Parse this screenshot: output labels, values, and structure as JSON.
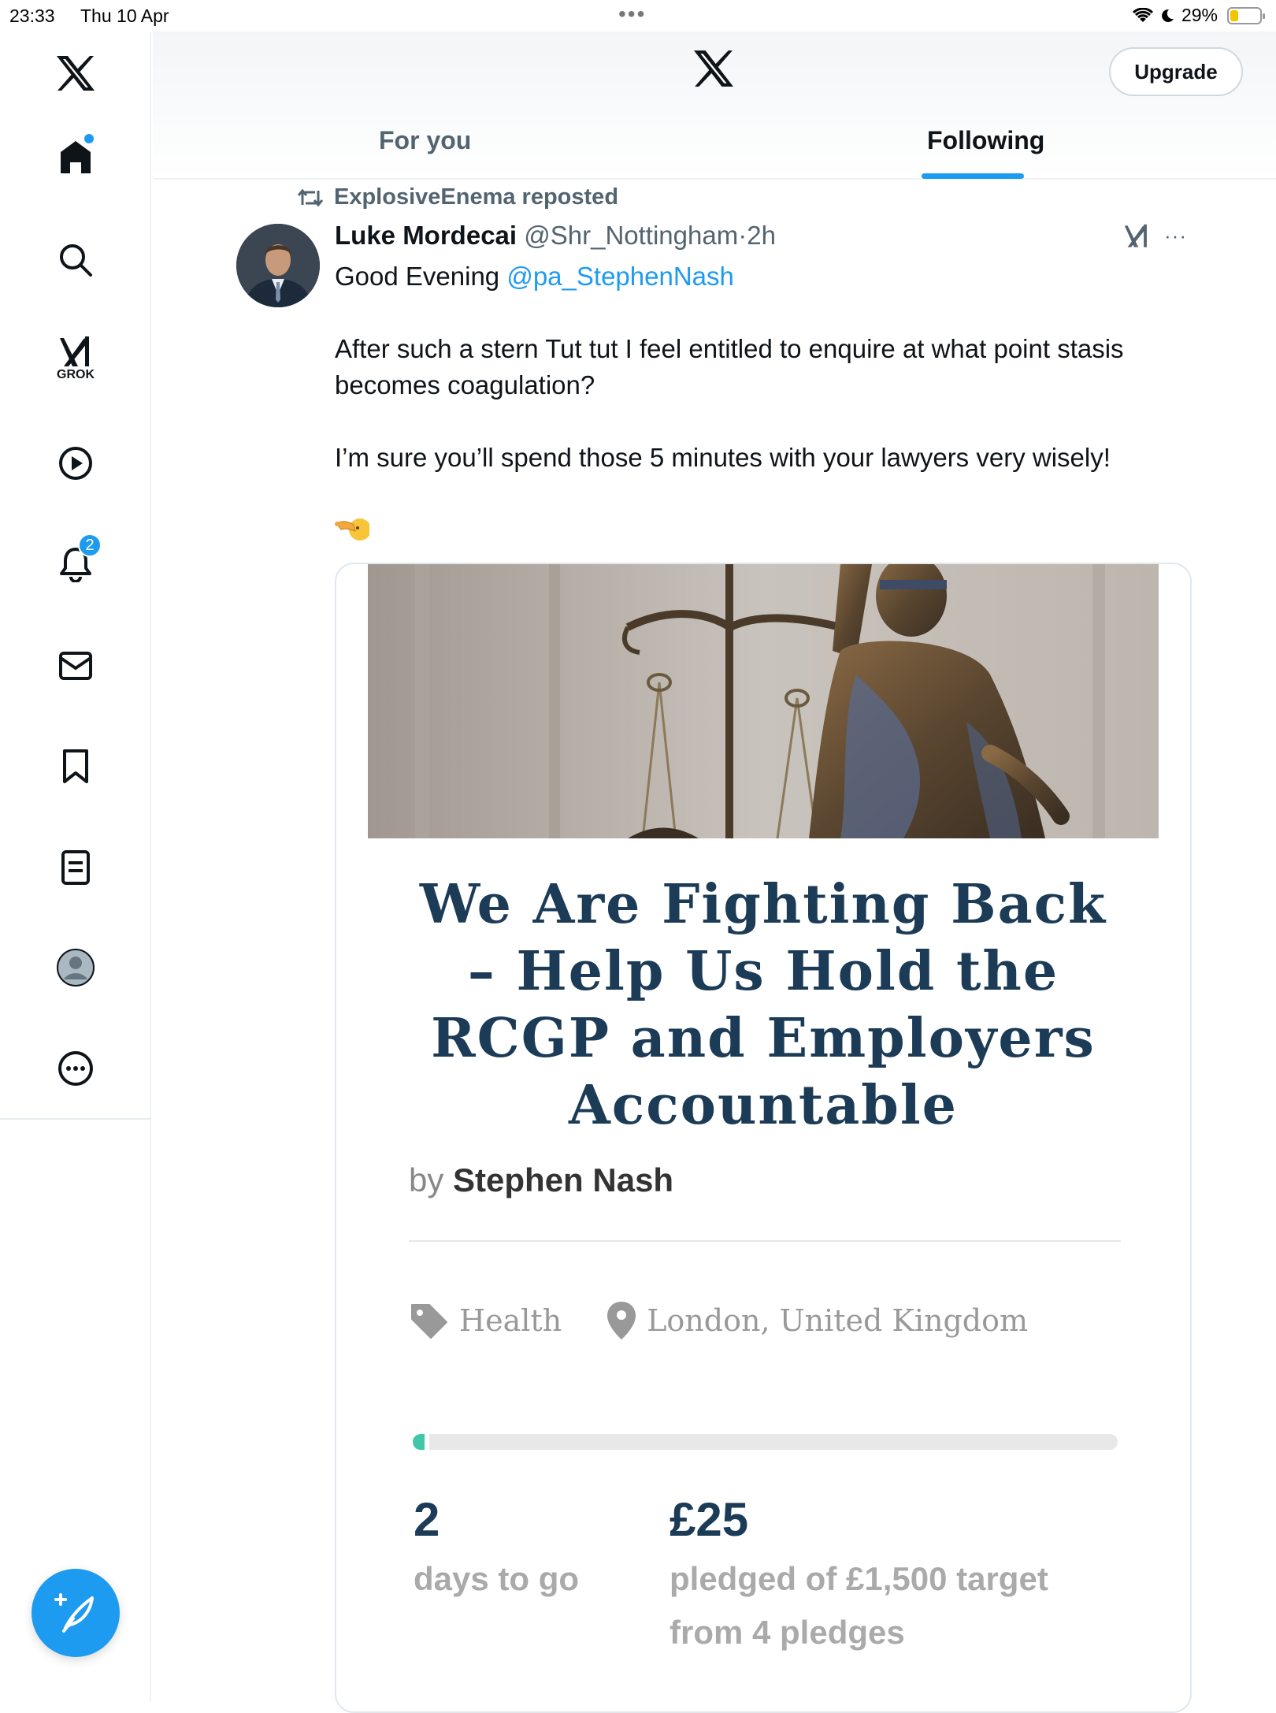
{
  "status_bar": {
    "time": "23:33",
    "date": "Thu 10 Apr",
    "battery_text": "29%",
    "battery_level": 0.29
  },
  "sidebar": {
    "grok_label": "GROK",
    "notification_count": "2",
    "icons": [
      "x-logo-icon",
      "home-icon",
      "search-icon",
      "grok-icon",
      "video-icon",
      "bell-icon",
      "mail-icon",
      "bookmark-icon",
      "list-icon",
      "profile-icon",
      "more-icon",
      "compose-icon"
    ]
  },
  "header": {
    "upgrade_label": "Upgrade",
    "tabs": [
      {
        "label": "For you",
        "active": false
      },
      {
        "label": "Following",
        "active": true
      }
    ]
  },
  "tweet": {
    "reposted_by": "ExplosiveEnema reposted",
    "author_name": "Luke Mordecai",
    "author_handle": "@Shr_Nottingham",
    "separator": "·",
    "time": "2h",
    "more": "···",
    "greeting": "Good Evening",
    "mention": "@pa_StephenNash",
    "paragraph_1": "After such a stern Tut tut I feel entitled to enquire at what point stasis becomes coagulation?",
    "paragraph_2": "I’m sure you’ll spend those 5 minutes with your lawyers very wisely!",
    "emoji": "🫵"
  },
  "card": {
    "title_lines": [
      "We Are Fighting Back",
      "– Help Us Hold the",
      "RCGP and Employers",
      "Accountable"
    ],
    "by_prefix": "by",
    "by_name": "Stephen Nash",
    "category": "Health",
    "location": "London, United Kingdom",
    "progress_fraction": 0.0167,
    "days_value": "2",
    "days_label": "days to go",
    "pledged_value": "£25",
    "pledged_label_1": "pledged of £1,500 target",
    "pledged_label_2": "from 4 pledges"
  },
  "colors": {
    "accent": "#1d9bf0",
    "title_navy": "#1b3b57",
    "progress_green": "#3fc7a8"
  }
}
